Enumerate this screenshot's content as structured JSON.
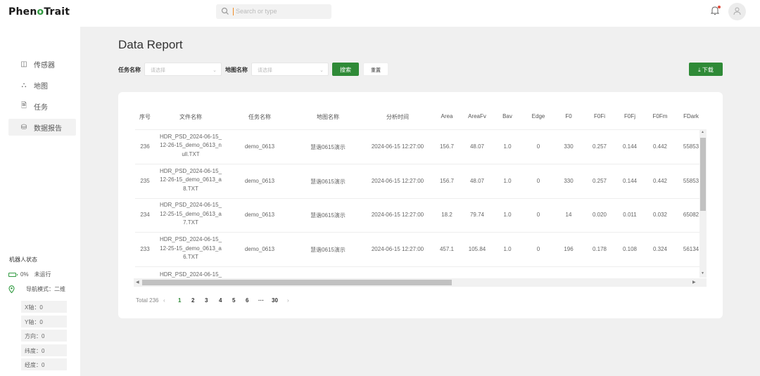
{
  "app": {
    "logo_a": "Phen",
    "logo_o": "o",
    "logo_b": "Trait"
  },
  "search": {
    "placeholder": "Search or type"
  },
  "sidebar": {
    "items": [
      {
        "icon": "sensor-icon",
        "glyph": "◫",
        "label": "传感器"
      },
      {
        "icon": "map-icon",
        "glyph": "⛬",
        "label": "地图"
      },
      {
        "icon": "task-icon",
        "glyph": "🗎",
        "label": "任务"
      },
      {
        "icon": "report-icon",
        "glyph": "⛁",
        "label": "数据报告"
      }
    ],
    "active_index": 3,
    "robot_status_title": "机器人状态",
    "battery": "0%",
    "run_state": "未运行",
    "nav_mode": "导航模式：二维",
    "coords": [
      "X轴：0",
      "Y轴：0",
      "方向：0",
      "纬度：0",
      "经度：0"
    ]
  },
  "page": {
    "title": "Data Report"
  },
  "filters": {
    "task_label": "任务名称",
    "task_placeholder": "请选择",
    "map_label": "地图名称",
    "map_placeholder": "请选择",
    "search_button": "搜索",
    "reset_button": "重置",
    "download_button": "⤓ 下载"
  },
  "table": {
    "columns": [
      "序号",
      "文件名称",
      "任务名称",
      "地图名称",
      "分析时间",
      "Area",
      "AreaFv",
      "Bav",
      "Edge",
      "F0",
      "F0Fi",
      "F0Fj",
      "F0Fm",
      "FDark"
    ],
    "rows": [
      {
        "id": "236",
        "file_lines": [
          "HDR_PSD_2024-06-15_",
          "12-26-15_demo_0613_n",
          "ull.TXT"
        ],
        "task": "demo_0613",
        "map": "慧谐0615演示",
        "time": "2024-06-15 12:27:00",
        "area": "156.7",
        "areafv": "48.07",
        "bav": "1.0",
        "edge": "0",
        "f0": "330",
        "f0fi": "0.257",
        "f0fj": "0.144",
        "f0fm": "0.442",
        "fdark": "55853"
      },
      {
        "id": "235",
        "file_lines": [
          "HDR_PSD_2024-06-15_",
          "12-26-15_demo_0613_a",
          "8.TXT"
        ],
        "task": "demo_0613",
        "map": "慧谐0615演示",
        "time": "2024-06-15 12:27:00",
        "area": "156.7",
        "areafv": "48.07",
        "bav": "1.0",
        "edge": "0",
        "f0": "330",
        "f0fi": "0.257",
        "f0fj": "0.144",
        "f0fm": "0.442",
        "fdark": "55853"
      },
      {
        "id": "234",
        "file_lines": [
          "HDR_PSD_2024-06-15_",
          "12-25-15_demo_0613_a",
          "7.TXT"
        ],
        "task": "demo_0613",
        "map": "慧谐0615演示",
        "time": "2024-06-15 12:27:00",
        "area": "18.2",
        "areafv": "79.74",
        "bav": "1.0",
        "edge": "0",
        "f0": "14",
        "f0fi": "0.020",
        "f0fj": "0.011",
        "f0fm": "0.032",
        "fdark": "65082"
      },
      {
        "id": "233",
        "file_lines": [
          "HDR_PSD_2024-06-15_",
          "12-25-15_demo_0613_a",
          "6.TXT"
        ],
        "task": "demo_0613",
        "map": "慧谐0615演示",
        "time": "2024-06-15 12:27:00",
        "area": "457.1",
        "areafv": "105.84",
        "bav": "1.0",
        "edge": "0",
        "f0": "196",
        "f0fi": "0.178",
        "f0fj": "0.108",
        "f0fm": "0.324",
        "fdark": "56134"
      }
    ],
    "partial_row_file": "HDR_PSD_2024-06-15_"
  },
  "pagination": {
    "total": "Total 236",
    "prev": "‹",
    "pages": [
      "1",
      "2",
      "3",
      "4",
      "5",
      "6"
    ],
    "ellipsis": "···",
    "last": "30",
    "next": "›"
  },
  "colors": {
    "accent": "#2f8a37",
    "logo_o": "#2f9a3f"
  }
}
